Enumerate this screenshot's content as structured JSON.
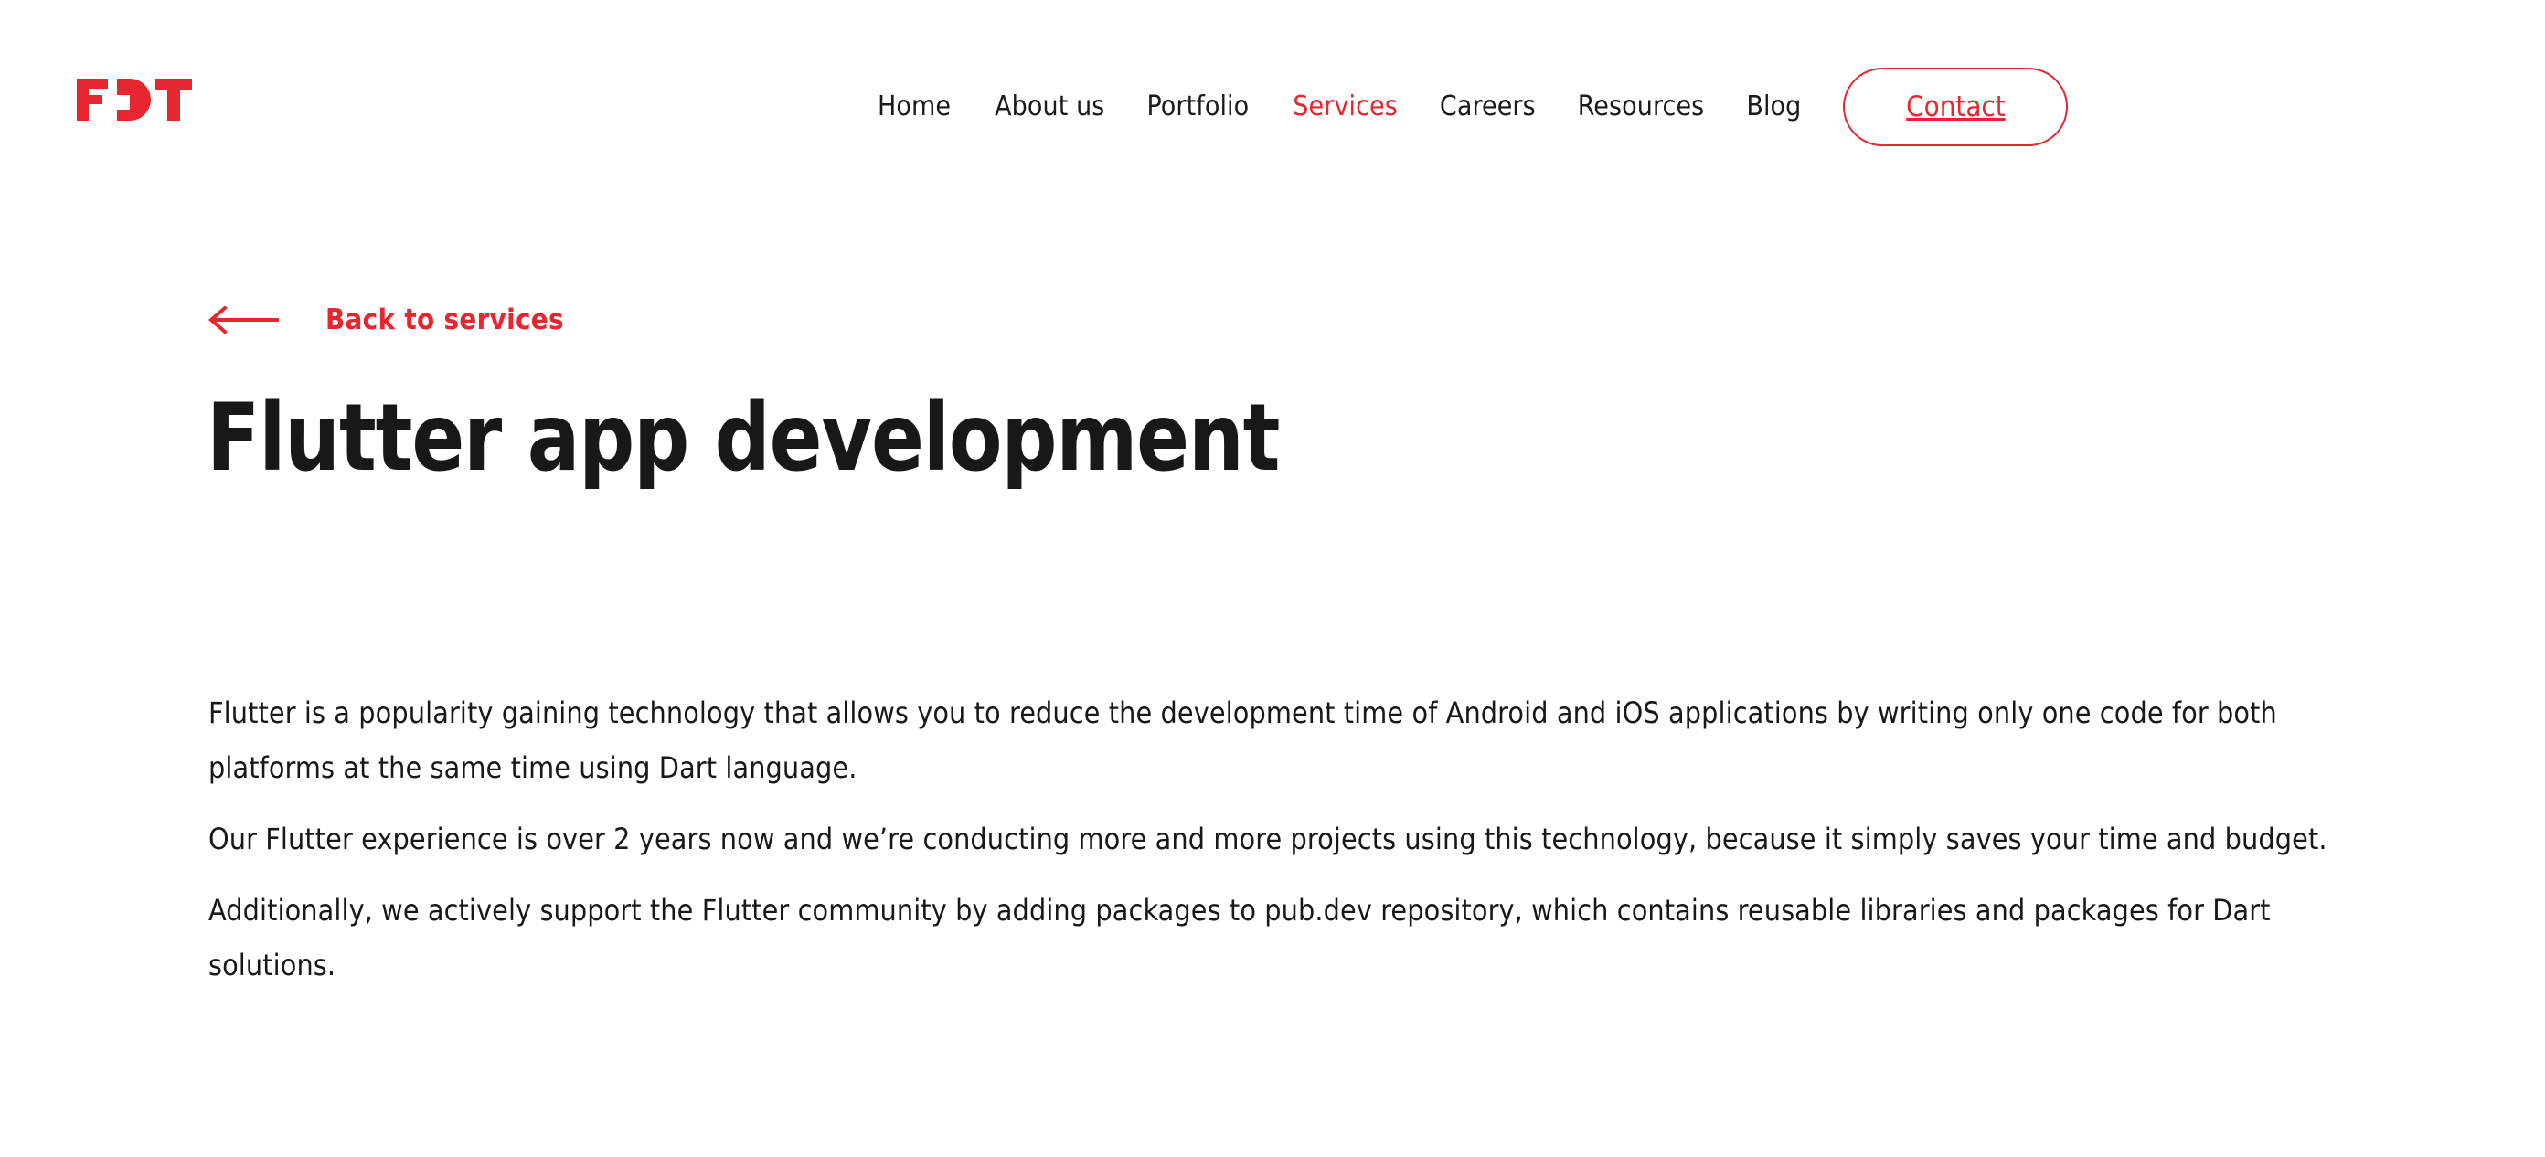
{
  "brand": {
    "logo_text": "FDT",
    "accent_color": "#e8262f",
    "text_color": "#17181a"
  },
  "nav": {
    "items": [
      {
        "label": "Home",
        "active": false
      },
      {
        "label": "About us",
        "active": false
      },
      {
        "label": "Portfolio",
        "active": false
      },
      {
        "label": "Services",
        "active": true
      },
      {
        "label": "Careers",
        "active": false
      },
      {
        "label": "Resources",
        "active": false
      },
      {
        "label": "Blog",
        "active": false
      }
    ],
    "cta_label": "Contact"
  },
  "main": {
    "back_link_label": "Back to services",
    "back_arrow_icon": "arrow-left-icon",
    "title": "Flutter app development",
    "paragraphs": [
      "Flutter is a popularity gaining technology that allows you to reduce the development time of Android and iOS applications by writing only one code for both platforms at the same time using Dart language.",
      "Our Flutter experience is over 2 years now and we’re conducting more and more projects using this technology, because it simply saves your time and budget.",
      "Additionally, we actively support the Flutter community by adding packages to pub.dev repository, which contains reusable libraries and packages for Dart solutions."
    ]
  }
}
